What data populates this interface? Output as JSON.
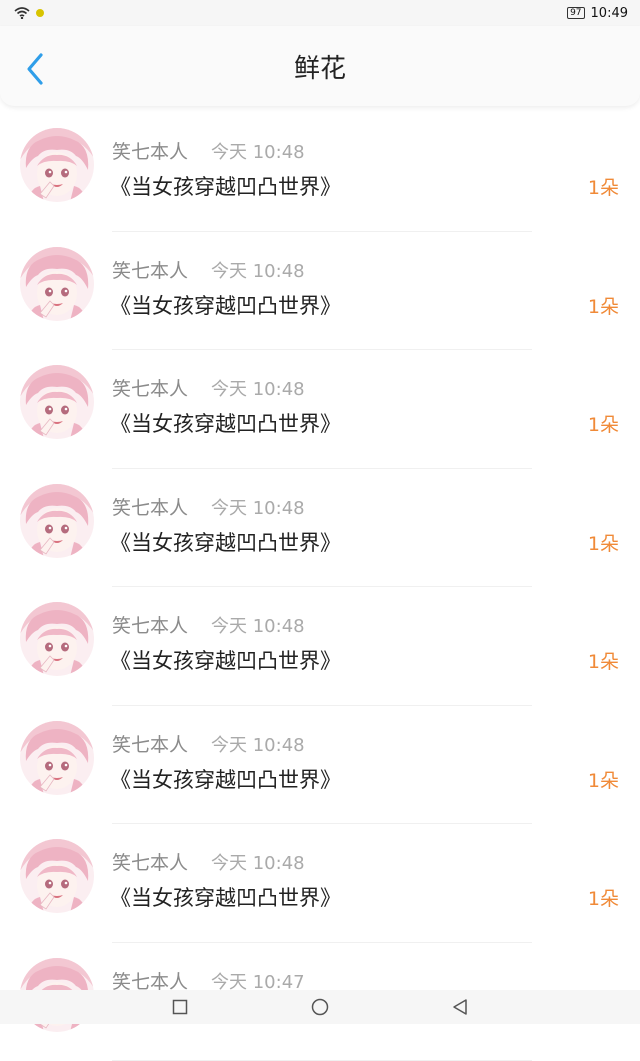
{
  "status_bar": {
    "battery": "97",
    "time": "10:49",
    "icons": [
      "wifi-icon",
      "notification-icon",
      "battery-icon"
    ]
  },
  "header": {
    "title": "鲜花",
    "back_icon": "chevron-left-icon"
  },
  "colors": {
    "accent_blue": "#2f9ee9",
    "amount_orange": "#f08a38"
  },
  "records": [
    {
      "user": "笑七本人",
      "time": "今天 10:48",
      "book": "《当女孩穿越凹凸世界》",
      "amount": "1朵"
    },
    {
      "user": "笑七本人",
      "time": "今天 10:48",
      "book": "《当女孩穿越凹凸世界》",
      "amount": "1朵"
    },
    {
      "user": "笑七本人",
      "time": "今天 10:48",
      "book": "《当女孩穿越凹凸世界》",
      "amount": "1朵"
    },
    {
      "user": "笑七本人",
      "time": "今天 10:48",
      "book": "《当女孩穿越凹凸世界》",
      "amount": "1朵"
    },
    {
      "user": "笑七本人",
      "time": "今天 10:48",
      "book": "《当女孩穿越凹凸世界》",
      "amount": "1朵"
    },
    {
      "user": "笑七本人",
      "time": "今天 10:48",
      "book": "《当女孩穿越凹凸世界》",
      "amount": "1朵"
    },
    {
      "user": "笑七本人",
      "time": "今天 10:48",
      "book": "《当女孩穿越凹凸世界》",
      "amount": "1朵"
    },
    {
      "user": "笑七本人",
      "time": "今天 10:47",
      "book": "",
      "amount": ""
    }
  ],
  "nav_bar": {
    "icons": [
      "recents-square-icon",
      "home-circle-icon",
      "back-triangle-icon"
    ]
  }
}
